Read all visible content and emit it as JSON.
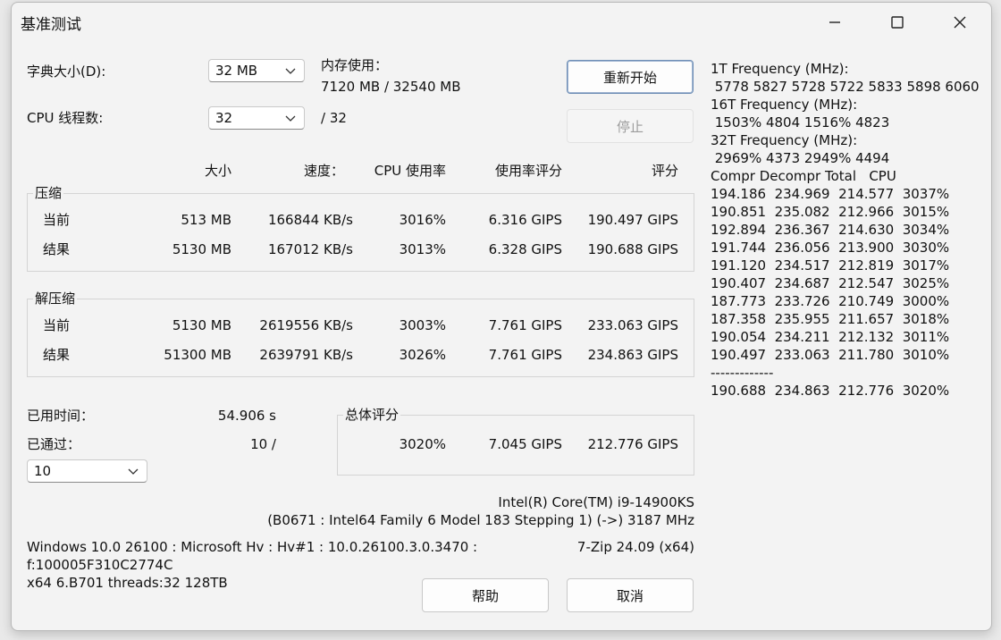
{
  "window": {
    "title": "基准测试",
    "minimize_icon": "minimize-icon",
    "maximize_icon": "maximize-icon",
    "close_icon": "close-icon"
  },
  "settings": {
    "dict_label": "字典大小(D):",
    "dict_value": "32 MB",
    "threads_label": "CPU 线程数:",
    "threads_value": "32",
    "threads_max": "/ 32",
    "mem_label": "内存使用：",
    "mem_value": "7120 MB / 32540 MB"
  },
  "buttons": {
    "restart": "重新开始",
    "stop": "停止",
    "help": "帮助",
    "cancel": "取消"
  },
  "columns": {
    "size": "大小",
    "speed": "速度：",
    "cpu": "CPU 使用率",
    "rating_per": "使用率评分",
    "rating": "评分"
  },
  "compress": {
    "legend": "压缩",
    "rows": [
      {
        "label": "当前",
        "size": "513 MB",
        "speed": "166844 KB/s",
        "cpu": "3016%",
        "rpu": "6.316 GIPS",
        "rating": "190.497 GIPS"
      },
      {
        "label": "结果",
        "size": "5130 MB",
        "speed": "167012 KB/s",
        "cpu": "3013%",
        "rpu": "6.328 GIPS",
        "rating": "190.688 GIPS"
      }
    ]
  },
  "decompress": {
    "legend": "解压缩",
    "rows": [
      {
        "label": "当前",
        "size": "5130 MB",
        "speed": "2619556 KB/s",
        "cpu": "3003%",
        "rpu": "7.761 GIPS",
        "rating": "233.063 GIPS"
      },
      {
        "label": "结果",
        "size": "51300 MB",
        "speed": "2639791 KB/s",
        "cpu": "3026%",
        "rpu": "7.761 GIPS",
        "rating": "234.863 GIPS"
      }
    ]
  },
  "status": {
    "elapsed_label": "已用时间：",
    "elapsed_value": "54.906 s",
    "passes_label": "已通过：",
    "passes_value": "10 /",
    "passes_combo": "10"
  },
  "total": {
    "legend": "总体评分",
    "cpu": "3020%",
    "rpu": "7.045 GIPS",
    "rating": "212.776 GIPS"
  },
  "cpu_info": {
    "name": "Intel(R) Core(TM) i9-14900KS",
    "detail": "(B0671 : Intel64 Family 6 Model 183 Stepping 1) (->) 3187 MHz"
  },
  "sys_info": {
    "line1": "Windows 10.0 26100 : Microsoft Hv : Hv#1 : 10.0.26100.3.0.3470 :",
    "line2": "f:100005F310C2774C",
    "line3": "x64 6.B701 threads:32 128TB",
    "version": "7-Zip 24.09 (x64)"
  },
  "log": {
    "lines": [
      "1T Frequency (MHz):",
      " 5778 5827 5728 5722 5833 5898 6060",
      "16T Frequency (MHz):",
      " 1503% 4804 1516% 4823",
      "32T Frequency (MHz):",
      " 2969% 4373 2949% 4494",
      "Compr Decompr Total   CPU",
      "194.186  234.969  214.577  3037%",
      "190.851  235.082  212.966  3015%",
      "192.894  236.367  214.630  3034%",
      "191.744  236.056  213.900  3030%",
      "191.120  234.517  212.819  3017%",
      "190.407  234.687  212.547  3025%",
      "187.773  233.726  210.749  3000%",
      "187.358  235.955  211.657  3018%",
      "190.054  234.211  212.132  3011%",
      "190.497  233.063  211.780  3010%",
      "-------------",
      "190.688  234.863  212.776  3020%"
    ]
  }
}
